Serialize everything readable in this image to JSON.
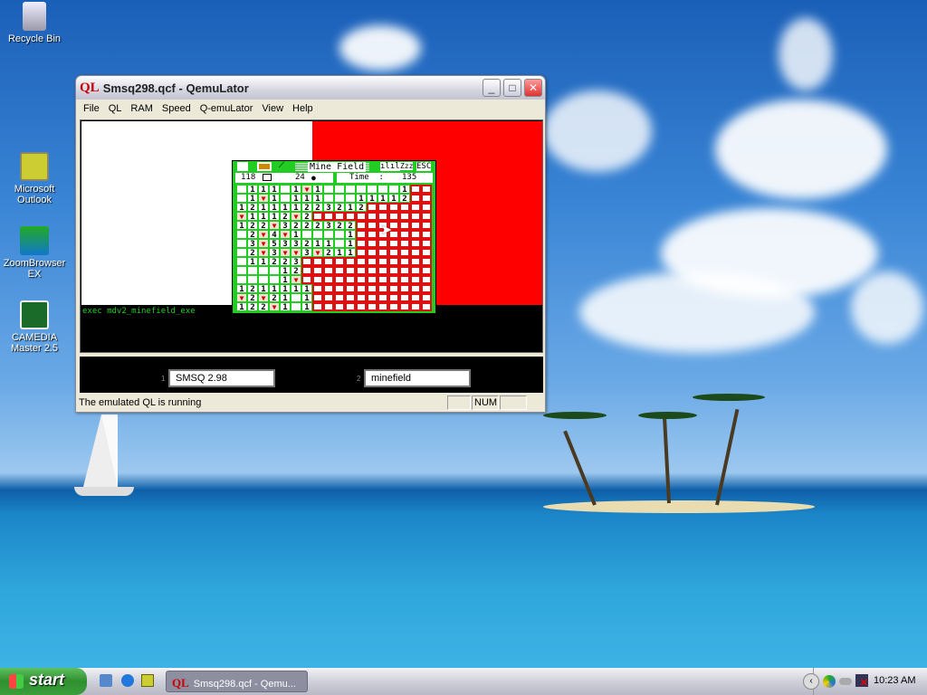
{
  "desktop": {
    "icons": [
      {
        "label": "Recycle Bin",
        "icon": "recycle-bin-icon"
      },
      {
        "label": "Microsoft Outlook",
        "icon": "outlook-icon"
      },
      {
        "label": "ZoomBrowser EX",
        "icon": "zoombrowser-icon"
      },
      {
        "label": "CAMEDIA Master 2.5",
        "icon": "camedia-icon"
      }
    ]
  },
  "window": {
    "logo": "QL",
    "title": "Smsq298.qcf - QemuLator",
    "menu": [
      "File",
      "QL",
      "RAM",
      "Speed",
      "Q-emuLator",
      "View",
      "Help"
    ],
    "console_text": "exec mdv2_minefield_exe",
    "fields": [
      {
        "num": "1",
        "value": "SMSQ 2.98"
      },
      {
        "num": "2",
        "value": "minefield"
      }
    ],
    "status": "The emulated QL is running",
    "num_indicator": "NUM"
  },
  "minefield": {
    "title": "Mine Field",
    "remaining": "118",
    "mines": "24",
    "time_label": "Time  :",
    "time": "135",
    "esc": "ESC",
    "zz": "Zzz",
    "colors": {
      "revealed": "#22cc22",
      "unrevealed": "#dd1111",
      "flag": "#cc0000"
    },
    "grid": [
      " 111 1F1       1##",
      " 1F1 111   11112##",
      "121111223212######",
      "F1112F2###########",
      "122F3222322#######",
      " 2F4F1    1#######",
      " 3F533211 1#######",
      " 2F3FF3F211#######",
      " 11223############",
      "    12############",
      "    1F############",
      "1211111###########",
      "F2F21 1###########",
      "122F1 1###########"
    ]
  },
  "taskbar": {
    "start": "start",
    "task": "Smsq298.qcf - Qemu...",
    "task_logo": "QL",
    "clock": "10:23 AM"
  }
}
